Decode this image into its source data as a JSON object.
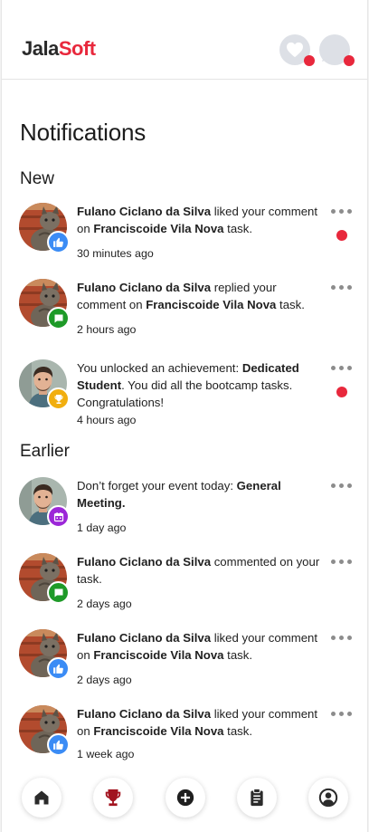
{
  "brand": {
    "part1": "Jala",
    "part2": "Soft"
  },
  "header": {
    "icons": [
      "heart-icon",
      "chat-bubble-icon"
    ],
    "accent": "#e8283c"
  },
  "page_title": "Notifications",
  "sections": {
    "new": "New",
    "earlier": "Earlier"
  },
  "notifications": [
    {
      "pre": "",
      "bold1": "Fulano Ciclano da Silva",
      "mid": " liked your comment on ",
      "bold2": "Franciscoide Vila Nova",
      "post": " task.",
      "time": "30 minutes ago",
      "badge": "like-icon",
      "unread": true
    },
    {
      "pre": "",
      "bold1": "Fulano Ciclano da Silva",
      "mid": " replied your comment on ",
      "bold2": "Franciscoide Vila Nova",
      "post": " task.",
      "time": "2 hours ago",
      "badge": "comment-icon",
      "unread": false
    },
    {
      "pre": "You unlocked an achievement: ",
      "bold1": "Dedicated Student",
      "mid": ". You did all the bootcamp tasks. Congratulations!",
      "bold2": "",
      "post": "",
      "time": "4 hours ago",
      "badge": "trophy-icon",
      "unread": true
    },
    {
      "pre": "Don’t forget your event today: ",
      "bold1": "General Meeting.",
      "mid": "",
      "bold2": "",
      "post": "",
      "time": "1 day ago",
      "badge": "calendar-icon",
      "unread": false
    },
    {
      "pre": "",
      "bold1": "Fulano Ciclano da Silva",
      "mid": " commented on your task.",
      "bold2": "",
      "post": "",
      "time": "2 days ago",
      "badge": "comment-icon",
      "unread": false
    },
    {
      "pre": "",
      "bold1": "Fulano Ciclano da Silva",
      "mid": " liked your comment on ",
      "bold2": "Franciscoide Vila Nova",
      "post": " task.",
      "time": "2 days ago",
      "badge": "like-icon",
      "unread": false
    },
    {
      "pre": "",
      "bold1": "Fulano Ciclano da Silva",
      "mid": " liked your comment on ",
      "bold2": "Franciscoide Vila Nova",
      "post": " task.",
      "time": "1 week ago",
      "badge": "like-icon",
      "unread": false
    }
  ],
  "badge_colors": {
    "like": "#3b8cf5",
    "comment": "#1e9a28",
    "trophy": "#f1ae0f",
    "calendar": "#9c27d8"
  },
  "bottom_nav": [
    "home-icon",
    "trophy-icon",
    "add-icon",
    "clipboard-icon",
    "profile-icon"
  ]
}
